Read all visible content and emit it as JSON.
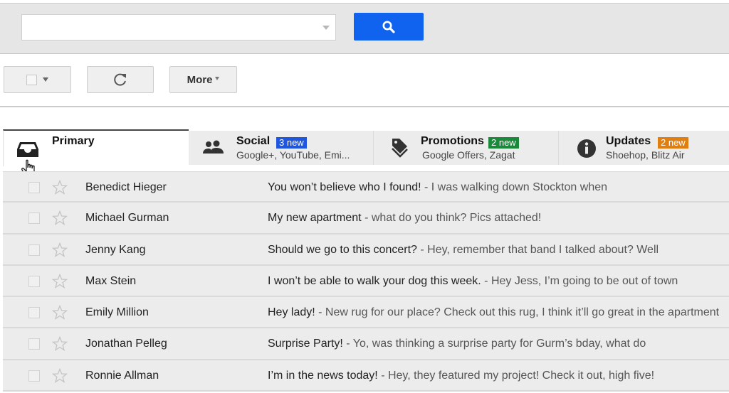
{
  "search": {
    "value": "",
    "placeholder": "",
    "button_icon": "search-icon"
  },
  "toolbar": {
    "select_icon": "checkbox-icon",
    "refresh_icon": "refresh-icon",
    "more_label": "More"
  },
  "tabs": [
    {
      "id": "primary",
      "label": "Primary",
      "icon": "inbox-icon",
      "active": true
    },
    {
      "id": "social",
      "label": "Social",
      "badge": "3 new",
      "subtitle": "Google+, YouTube, Emi...",
      "icon": "people-icon",
      "badge_color": "#1e56e0"
    },
    {
      "id": "promotions",
      "label": "Promotions",
      "badge": "2 new",
      "subtitle": "Google Offers, Zagat",
      "icon": "tag-icon",
      "badge_color": "#1a8a3a"
    },
    {
      "id": "updates",
      "label": "Updates",
      "badge": "2 new",
      "subtitle": "Shoehop, Blitz Air",
      "icon": "info-icon",
      "badge_color": "#e07f10"
    }
  ],
  "emails": [
    {
      "sender": "Benedict Hieger",
      "subject": "You won’t believe who I found!",
      "snippet": " - I was walking down Stockton when"
    },
    {
      "sender": "Michael Gurman",
      "subject": "My new apartment ",
      "snippet": " - what do you think? Pics attached!"
    },
    {
      "sender": "Jenny Kang",
      "subject": "Should we go to this concert? ",
      "snippet": " - Hey, remember that band I talked about? Well"
    },
    {
      "sender": "Max Stein",
      "subject": "I won’t be able to walk your dog this week. ",
      "snippet": " - Hey Jess, I’m going to be out of town"
    },
    {
      "sender": "Emily Million",
      "subject": "Hey lady! ",
      "snippet": " - New rug for our place? Check out this rug, I think it’ll go great in the apartment"
    },
    {
      "sender": "Jonathan Pelleg",
      "subject": "Surprise Party! ",
      "snippet": " - Yo, was thinking a surprise party for Gurm’s bday, what do"
    },
    {
      "sender": "Ronnie Allman",
      "subject": "I’m in the news today!",
      "snippet": " - Hey, they featured my project! Check it out, high five!"
    }
  ],
  "colors": {
    "search_button": "#0f63ee",
    "social_badge": "#1e56e0",
    "promotions_badge": "#1a8a3a",
    "updates_badge": "#e07f10"
  }
}
